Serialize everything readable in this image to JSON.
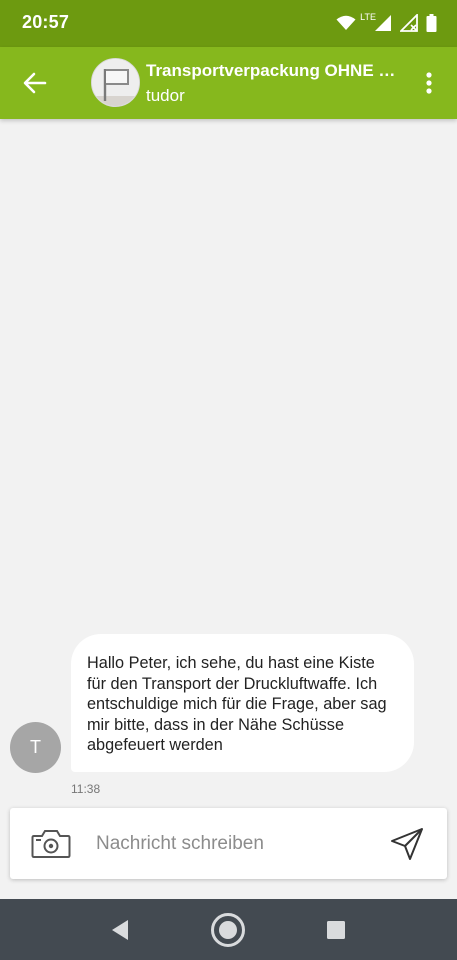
{
  "status_bar": {
    "time": "20:57",
    "network_label": "LTE",
    "icons": [
      "wifi-icon",
      "signal-icon",
      "signal-no-data-icon",
      "battery-icon"
    ]
  },
  "header": {
    "title": "Transportverpackung OHNE G...",
    "subtitle": "tudor",
    "accent_color": "#86b81d",
    "status_color": "#6d9a10"
  },
  "messages": [
    {
      "sender_initial": "T",
      "text": "Hallo Peter, ich sehe, du hast eine Kiste für den Transport der Druckluftwaffe. Ich entschuldige mich für die Frage, aber sag mir bitte, dass in der Nähe Schüsse abgefeuert werden",
      "time": "11:38"
    }
  ],
  "composer": {
    "placeholder": "Nachricht schreiben",
    "value": ""
  },
  "nav": {
    "buttons": [
      "back-nav-icon",
      "home-nav-icon",
      "recents-nav-icon"
    ]
  }
}
